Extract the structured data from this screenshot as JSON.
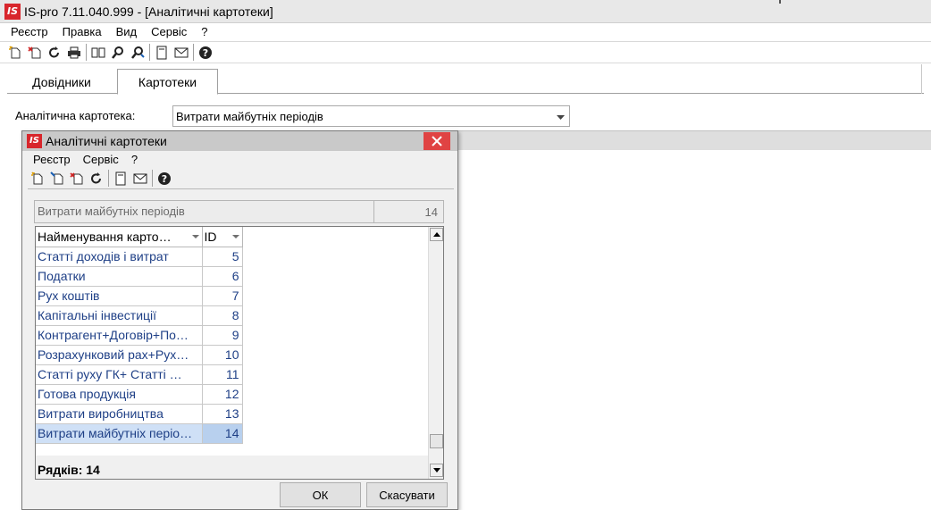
{
  "window": {
    "logo": "IS",
    "title": "IS-pro 7.11.040.999 - [Аналітичні картотеки]"
  },
  "main_menu": [
    {
      "label": "Реєстр"
    },
    {
      "label": "Правка"
    },
    {
      "label": "Вид"
    },
    {
      "label": "Сервіс"
    },
    {
      "label": "?"
    }
  ],
  "main_toolbar_icons": [
    "new-doc-icon",
    "delete-doc-icon",
    "refresh-icon",
    "print-icon",
    "book-icon",
    "find-icon",
    "find-replace-icon",
    "calc-icon",
    "mail-icon",
    "help-icon"
  ],
  "tabs": [
    {
      "label": "Довідники",
      "active": false
    },
    {
      "label": "Картотеки",
      "active": true
    }
  ],
  "card_selector": {
    "label": "Аналітична картотека:",
    "value": "Витрати майбутніх періодів"
  },
  "dialog": {
    "logo": "IS",
    "title": "Аналітичні картотеки",
    "menu": [
      {
        "label": "Реєстр"
      },
      {
        "label": "Сервіс"
      },
      {
        "label": "?"
      }
    ],
    "toolbar_icons": [
      "new-doc-icon",
      "edit-doc-icon",
      "delete-doc-icon",
      "refresh-icon",
      "calc-icon",
      "mail-icon",
      "help-icon"
    ],
    "info": {
      "name": "Витрати майбутніх періодів",
      "count": "14"
    },
    "grid": {
      "columns": [
        {
          "label": "Найменування карто…"
        },
        {
          "label": "ID"
        }
      ],
      "rows": [
        {
          "name": "Статті доходів і витрат",
          "id": "5"
        },
        {
          "name": "Податки",
          "id": "6"
        },
        {
          "name": "Рух коштів",
          "id": "7"
        },
        {
          "name": "Капітальні інвестиції",
          "id": "8"
        },
        {
          "name": "Контрагент+Договір+По…",
          "id": "9"
        },
        {
          "name": "Розрахунковий рах+Рух…",
          "id": "10"
        },
        {
          "name": "Статті руху ГК+ Статті …",
          "id": "11"
        },
        {
          "name": "Готова продукція",
          "id": "12"
        },
        {
          "name": "Витрати виробництва",
          "id": "13"
        },
        {
          "name": "Витрати майбутніх періо…",
          "id": "14",
          "selected": true
        }
      ],
      "footer": "Рядків: 14"
    },
    "ok_label": "ОК",
    "cancel_label": "Скасувати"
  },
  "colors": {
    "logo_red": "#d8262c",
    "close_red": "#e04343",
    "cell_text": "#1e3f86",
    "selection": "#cfe0f6"
  }
}
